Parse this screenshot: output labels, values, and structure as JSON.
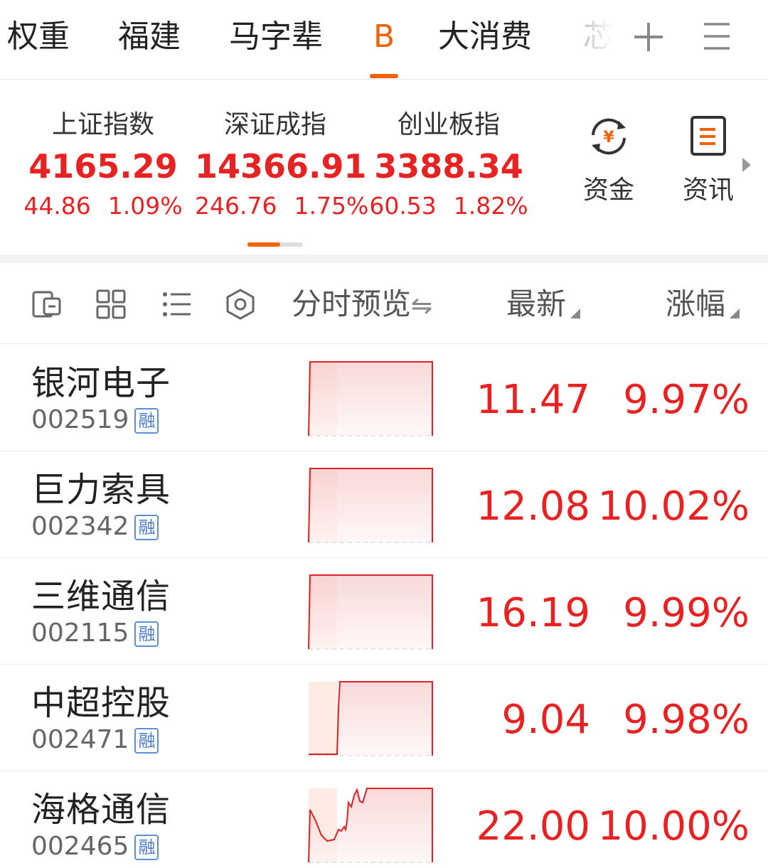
{
  "tabs": [
    {
      "label": "权重",
      "active": false
    },
    {
      "label": "福建",
      "active": false
    },
    {
      "label": "马字辈",
      "active": false
    },
    {
      "label": "B",
      "active": true
    },
    {
      "label": "大消费",
      "active": false
    },
    {
      "label": "芯",
      "active": false
    }
  ],
  "tab_actions": {
    "add_icon": "plus-icon",
    "menu_icon": "hamburger-menu-icon"
  },
  "indices": [
    {
      "name": "上证指数",
      "value": "4165.29",
      "change": "44.86",
      "pct": "1.09%"
    },
    {
      "name": "深证成指",
      "value": "14366.91",
      "change": "246.76",
      "pct": "1.75%"
    },
    {
      "name": "创业板指",
      "value": "3388.34",
      "change": "60.53",
      "pct": "1.82%"
    }
  ],
  "quick_links": [
    {
      "label": "资金",
      "icon": "fund-flow-icon"
    },
    {
      "label": "资讯",
      "icon": "news-icon"
    }
  ],
  "toolbar": {
    "icons": [
      "edit-list-icon",
      "grid-view-icon",
      "list-view-icon",
      "settings-hex-icon"
    ],
    "preview_label": "分时预览",
    "swap_icon": "swap-icon",
    "latest_label": "最新",
    "change_label": "涨幅"
  },
  "stocks": [
    {
      "name": "银河电子",
      "code": "002519",
      "badge": "融",
      "price": "11.47",
      "pct": "9.97%"
    },
    {
      "name": "巨力索具",
      "code": "002342",
      "badge": "融",
      "price": "12.08",
      "pct": "10.02%"
    },
    {
      "name": "三维通信",
      "code": "002115",
      "badge": "融",
      "price": "16.19",
      "pct": "9.99%"
    },
    {
      "name": "中超控股",
      "code": "002471",
      "badge": "融",
      "price": "9.04",
      "pct": "9.98%"
    },
    {
      "name": "海格通信",
      "code": "002465",
      "badge": "融",
      "price": "22.00",
      "pct": "10.00%"
    }
  ],
  "colors": {
    "accent": "#f0620a",
    "up": "#e62222",
    "badge": "#4a7ccc"
  }
}
